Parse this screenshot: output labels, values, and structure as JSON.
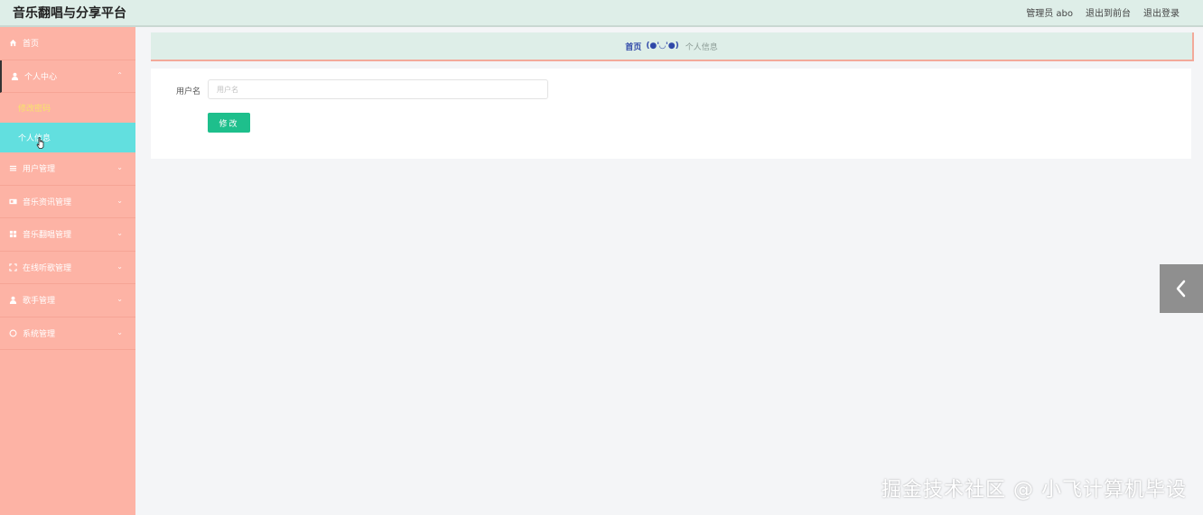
{
  "header": {
    "app_title": "音乐翻唱与分享平台",
    "admin_label": "管理员 abo",
    "back_to_front": "退出到前台",
    "logout": "退出登录"
  },
  "sidebar": {
    "items": [
      {
        "label": "首页",
        "icon": "home-icon"
      },
      {
        "label": "个人中心",
        "icon": "user-icon",
        "expanded": true,
        "children": [
          {
            "label": "修改密码"
          },
          {
            "label": "个人信息",
            "active": true
          }
        ]
      },
      {
        "label": "用户管理",
        "icon": "list-icon"
      },
      {
        "label": "音乐资讯管理",
        "icon": "news-icon"
      },
      {
        "label": "音乐翻唱管理",
        "icon": "grid-icon"
      },
      {
        "label": "在线听歌管理",
        "icon": "fullscreen-icon"
      },
      {
        "label": "歌手管理",
        "icon": "person-icon"
      },
      {
        "label": "系统管理",
        "icon": "circle-icon"
      }
    ]
  },
  "breadcrumb": {
    "home": "首页",
    "emote": "(●'◡'●)",
    "current": "个人信息"
  },
  "form": {
    "username_label": "用户名",
    "username_placeholder": "用户名",
    "username_value": "",
    "submit_label": "修改"
  },
  "watermark": "掘金技术社区 @ 小飞计算机毕设",
  "colors": {
    "sidebar_bg": "#fdb3a5",
    "active_item": "#62dfdf",
    "header_bg": "#deeee8",
    "button": "#1ebf8c"
  }
}
